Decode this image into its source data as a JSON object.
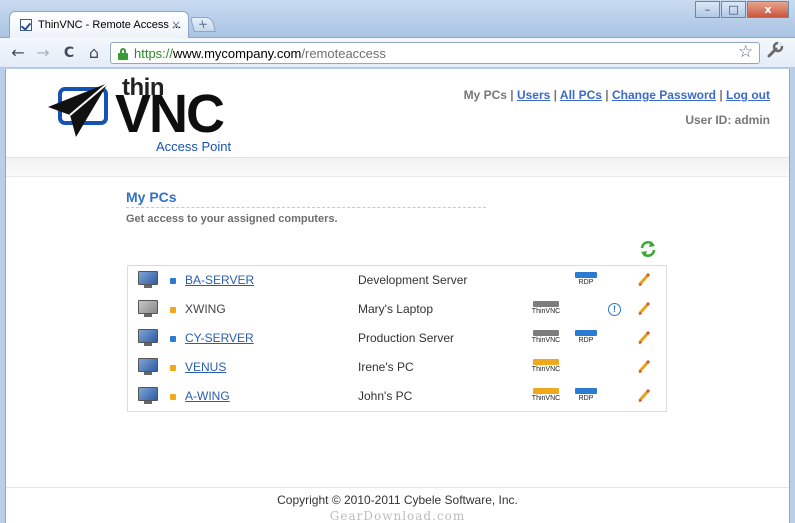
{
  "browser": {
    "tab_title": "ThinVNC - Remote Access ...",
    "tab_close": "×",
    "new_tab": "+",
    "window_buttons": {
      "minimize": "–",
      "maximize": "□",
      "close": "x"
    },
    "nav": {
      "back": "←",
      "forward": "→",
      "reload": "C",
      "home": "⌂"
    },
    "url": {
      "scheme": "https://",
      "host": "www.mycompany.com",
      "path": "/remoteaccess"
    },
    "star": "☆",
    "wrench": "🔧"
  },
  "logo": {
    "thin": "thin",
    "vnc": "VNC",
    "subtitle": "Access Point"
  },
  "topnav": {
    "items": [
      "My PCs",
      "Users",
      "All PCs",
      "Change Password",
      "Log out"
    ],
    "separator": " | ",
    "user_id": "User ID: admin"
  },
  "section": {
    "title": "My PCs",
    "subtitle": "Get access to your assigned computers."
  },
  "pcs": [
    {
      "name": "BA-SERVER",
      "description": "Development Server",
      "online": true,
      "status_color": "#2b7bd0",
      "thinvnc": false,
      "thinvnc_color": "#8a8a8a",
      "rdp": true,
      "info": false
    },
    {
      "name": "XWING",
      "description": "Mary's Laptop",
      "online": false,
      "status_color": "#f0a81c",
      "thinvnc": true,
      "thinvnc_color": "#7d7d7d",
      "rdp": false,
      "info": true
    },
    {
      "name": "CY-SERVER",
      "description": "Production Server",
      "online": true,
      "status_color": "#2b7bd0",
      "thinvnc": true,
      "thinvnc_color": "#7d7d7d",
      "rdp": true,
      "info": false
    },
    {
      "name": "VENUS",
      "description": "Irene's PC",
      "online": true,
      "status_color": "#f0a81c",
      "thinvnc": true,
      "thinvnc_color": "#f0a81c",
      "rdp": false,
      "info": false
    },
    {
      "name": "A-WING",
      "description": "John's PC",
      "online": true,
      "status_color": "#f0a81c",
      "thinvnc": true,
      "thinvnc_color": "#f0a81c",
      "rdp": true,
      "info": false
    }
  ],
  "labels": {
    "thinvnc": "ThinVNC",
    "rdp": "RDP",
    "info": "!"
  },
  "colors": {
    "rdp": "#2b7bd0",
    "link": "#3b6ac9",
    "title": "#3472c7"
  },
  "footer": {
    "copyright": "Copyright © 2010-2011 Cybele Software, Inc.",
    "watermark": "GearDownload.com"
  }
}
